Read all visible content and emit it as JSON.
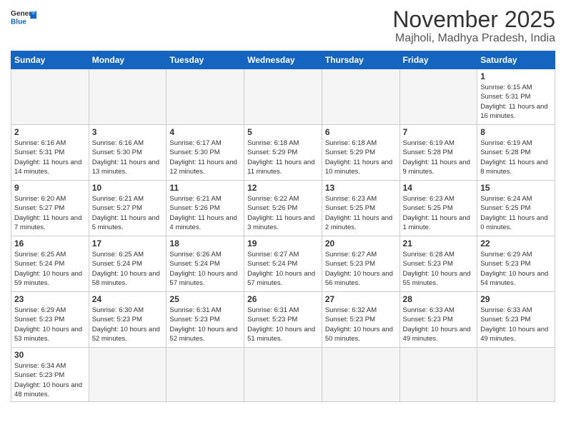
{
  "logo": {
    "general": "General",
    "blue": "Blue"
  },
  "title": "November 2025",
  "subtitle": "Majholi, Madhya Pradesh, India",
  "days_of_week": [
    "Sunday",
    "Monday",
    "Tuesday",
    "Wednesday",
    "Thursday",
    "Friday",
    "Saturday"
  ],
  "weeks": [
    [
      {
        "day": "",
        "info": ""
      },
      {
        "day": "",
        "info": ""
      },
      {
        "day": "",
        "info": ""
      },
      {
        "day": "",
        "info": ""
      },
      {
        "day": "",
        "info": ""
      },
      {
        "day": "",
        "info": ""
      },
      {
        "day": "1",
        "info": "Sunrise: 6:15 AM\nSunset: 5:31 PM\nDaylight: 11 hours and 16 minutes."
      }
    ],
    [
      {
        "day": "2",
        "info": "Sunrise: 6:16 AM\nSunset: 5:31 PM\nDaylight: 11 hours and 14 minutes."
      },
      {
        "day": "3",
        "info": "Sunrise: 6:16 AM\nSunset: 5:30 PM\nDaylight: 11 hours and 13 minutes."
      },
      {
        "day": "4",
        "info": "Sunrise: 6:17 AM\nSunset: 5:30 PM\nDaylight: 11 hours and 12 minutes."
      },
      {
        "day": "5",
        "info": "Sunrise: 6:18 AM\nSunset: 5:29 PM\nDaylight: 11 hours and 11 minutes."
      },
      {
        "day": "6",
        "info": "Sunrise: 6:18 AM\nSunset: 5:29 PM\nDaylight: 11 hours and 10 minutes."
      },
      {
        "day": "7",
        "info": "Sunrise: 6:19 AM\nSunset: 5:28 PM\nDaylight: 11 hours and 9 minutes."
      },
      {
        "day": "8",
        "info": "Sunrise: 6:19 AM\nSunset: 5:28 PM\nDaylight: 11 hours and 8 minutes."
      }
    ],
    [
      {
        "day": "9",
        "info": "Sunrise: 6:20 AM\nSunset: 5:27 PM\nDaylight: 11 hours and 7 minutes."
      },
      {
        "day": "10",
        "info": "Sunrise: 6:21 AM\nSunset: 5:27 PM\nDaylight: 11 hours and 5 minutes."
      },
      {
        "day": "11",
        "info": "Sunrise: 6:21 AM\nSunset: 5:26 PM\nDaylight: 11 hours and 4 minutes."
      },
      {
        "day": "12",
        "info": "Sunrise: 6:22 AM\nSunset: 5:26 PM\nDaylight: 11 hours and 3 minutes."
      },
      {
        "day": "13",
        "info": "Sunrise: 6:23 AM\nSunset: 5:25 PM\nDaylight: 11 hours and 2 minutes."
      },
      {
        "day": "14",
        "info": "Sunrise: 6:23 AM\nSunset: 5:25 PM\nDaylight: 11 hours and 1 minute."
      },
      {
        "day": "15",
        "info": "Sunrise: 6:24 AM\nSunset: 5:25 PM\nDaylight: 11 hours and 0 minutes."
      }
    ],
    [
      {
        "day": "16",
        "info": "Sunrise: 6:25 AM\nSunset: 5:24 PM\nDaylight: 10 hours and 59 minutes."
      },
      {
        "day": "17",
        "info": "Sunrise: 6:25 AM\nSunset: 5:24 PM\nDaylight: 10 hours and 58 minutes."
      },
      {
        "day": "18",
        "info": "Sunrise: 6:26 AM\nSunset: 5:24 PM\nDaylight: 10 hours and 57 minutes."
      },
      {
        "day": "19",
        "info": "Sunrise: 6:27 AM\nSunset: 5:24 PM\nDaylight: 10 hours and 57 minutes."
      },
      {
        "day": "20",
        "info": "Sunrise: 6:27 AM\nSunset: 5:23 PM\nDaylight: 10 hours and 56 minutes."
      },
      {
        "day": "21",
        "info": "Sunrise: 6:28 AM\nSunset: 5:23 PM\nDaylight: 10 hours and 55 minutes."
      },
      {
        "day": "22",
        "info": "Sunrise: 6:29 AM\nSunset: 5:23 PM\nDaylight: 10 hours and 54 minutes."
      }
    ],
    [
      {
        "day": "23",
        "info": "Sunrise: 6:29 AM\nSunset: 5:23 PM\nDaylight: 10 hours and 53 minutes."
      },
      {
        "day": "24",
        "info": "Sunrise: 6:30 AM\nSunset: 5:23 PM\nDaylight: 10 hours and 52 minutes."
      },
      {
        "day": "25",
        "info": "Sunrise: 6:31 AM\nSunset: 5:23 PM\nDaylight: 10 hours and 52 minutes."
      },
      {
        "day": "26",
        "info": "Sunrise: 6:31 AM\nSunset: 5:23 PM\nDaylight: 10 hours and 51 minutes."
      },
      {
        "day": "27",
        "info": "Sunrise: 6:32 AM\nSunset: 5:23 PM\nDaylight: 10 hours and 50 minutes."
      },
      {
        "day": "28",
        "info": "Sunrise: 6:33 AM\nSunset: 5:23 PM\nDaylight: 10 hours and 49 minutes."
      },
      {
        "day": "29",
        "info": "Sunrise: 6:33 AM\nSunset: 5:23 PM\nDaylight: 10 hours and 49 minutes."
      }
    ],
    [
      {
        "day": "30",
        "info": "Sunrise: 6:34 AM\nSunset: 5:23 PM\nDaylight: 10 hours and 48 minutes."
      },
      {
        "day": "",
        "info": ""
      },
      {
        "day": "",
        "info": ""
      },
      {
        "day": "",
        "info": ""
      },
      {
        "day": "",
        "info": ""
      },
      {
        "day": "",
        "info": ""
      },
      {
        "day": "",
        "info": ""
      }
    ]
  ]
}
